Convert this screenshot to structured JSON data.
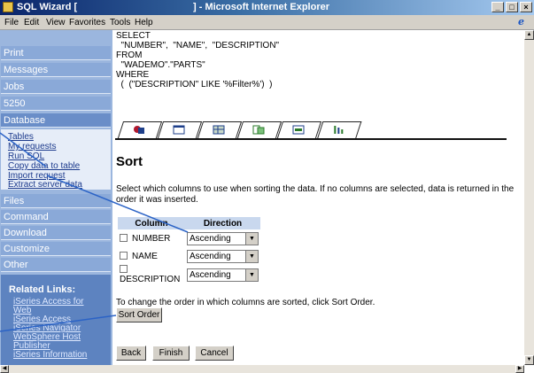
{
  "window": {
    "title_left": "SQL Wizard [",
    "title_center": "] - Microsoft Internet Explorer",
    "buttons": [
      "_",
      "□",
      "×"
    ]
  },
  "menu": [
    "File",
    "Edit",
    "View",
    "Favorites",
    "Tools",
    "Help"
  ],
  "nav": {
    "items": [
      "Print",
      "Messages",
      "Jobs",
      "5250",
      "Database",
      "Files",
      "Command",
      "Download",
      "Customize",
      "Other"
    ],
    "database_links": [
      "Tables",
      "My requests",
      "Run SQL",
      "Copy data to table",
      "Import request",
      "Extract server data"
    ],
    "related_heading": "Related Links:",
    "related_links": [
      "iSeries Access for",
      "Web",
      "iSeries Access",
      "iSeries Navigator",
      "WebSphere Host",
      "Publisher",
      "iSeries Information"
    ]
  },
  "sql": "SELECT\n  \"NUMBER\",  \"NAME\",  \"DESCRIPTION\"\nFROM\n  \"WADEMO\".\"PARTS\"\nWHERE\n  (  (\"DESCRIPTION\" LIKE '%Filter%')  )",
  "tabs": [
    {
      "icon": "sheet-icon"
    },
    {
      "icon": "table-icon"
    },
    {
      "icon": "grid-icon"
    },
    {
      "icon": "join-icon"
    },
    {
      "icon": "filter-icon"
    },
    {
      "icon": "sort-icon"
    }
  ],
  "sort": {
    "title": "Sort",
    "description": "Select which columns to use when sorting the data. If no columns are selected, data is returned in the order it was inserted.",
    "col_header": "Column",
    "dir_header": "Direction",
    "rows": [
      {
        "column": "NUMBER",
        "direction": "Ascending"
      },
      {
        "column": "NAME",
        "direction": "Ascending"
      },
      {
        "column": "DESCRIPTION",
        "direction": "Ascending"
      }
    ],
    "order_note": "To change the order in which columns are sorted, click Sort Order.",
    "sort_order_button": "Sort Order"
  },
  "footer_buttons": {
    "back": "Back",
    "finish": "Finish",
    "cancel": "Cancel"
  },
  "colors": {
    "nav_bg": "#9bb6de",
    "nav_item": "#8aa9d8",
    "related_bg": "#5d83c0",
    "header_bg": "#c9d8ee"
  }
}
